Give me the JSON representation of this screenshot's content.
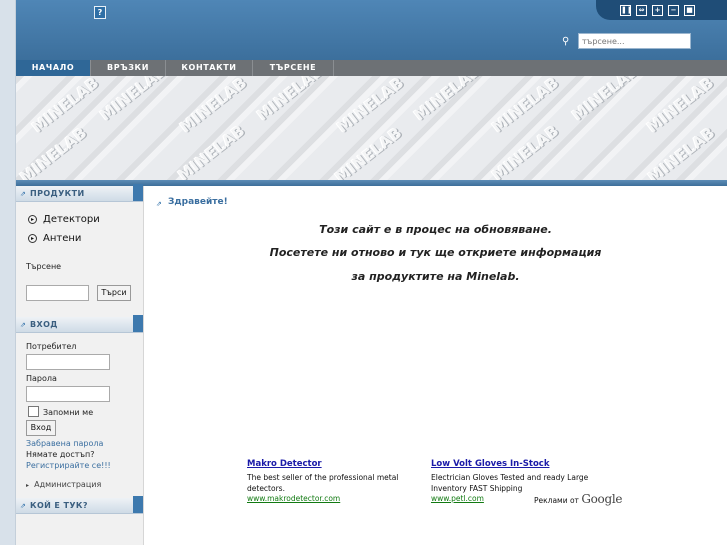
{
  "header": {
    "help_label": "?",
    "tools": [
      "❚❚",
      "⇔",
      "+",
      "−",
      "■"
    ],
    "search_placeholder": "търсене..."
  },
  "menu": [
    {
      "label": "НАЧАЛО",
      "active": true
    },
    {
      "label": "ВРЪЗКИ",
      "active": false
    },
    {
      "label": "КОНТАКТИ",
      "active": false
    },
    {
      "label": "ТЪРСЕНЕ",
      "active": false
    }
  ],
  "banner": {
    "logo_text": "MINELAB"
  },
  "sidebar": {
    "products": {
      "title": "ПРОДУКТИ",
      "items": [
        "Детектори",
        "Антени"
      ],
      "search_label": "Търсене",
      "search_button": "Търси"
    },
    "login": {
      "title": "ВХОД",
      "username_label": "Потребител",
      "password_label": "Парола",
      "remember_label": "Запомни ме",
      "login_button": "Вход",
      "forgot_link": "Забравена парола",
      "no_account_text": "Нямате достъп?",
      "register_link": "Регистрирайте се!!!",
      "admin_link": "Администрация"
    },
    "whos_here": {
      "title": "КОЙ Е ТУК?"
    }
  },
  "main": {
    "greeting": "Здравейте!",
    "lines": [
      "Този сайт е в процес на обновяване.",
      "Посетете ни отново и тук ще откриете информация",
      "за продуктите на Minelab."
    ]
  },
  "ads": [
    {
      "title": "Makro Detector",
      "text": "The best seller of the professional metal detectors.",
      "url": "www.makrodetector.com"
    },
    {
      "title": "Low Volt Gloves In-Stock",
      "text": "Electrician Gloves Tested and ready Large Inventory FAST Shipping",
      "url": "www.petl.com"
    }
  ],
  "ads_by": {
    "label": "Реклами от",
    "brand": "Google"
  }
}
